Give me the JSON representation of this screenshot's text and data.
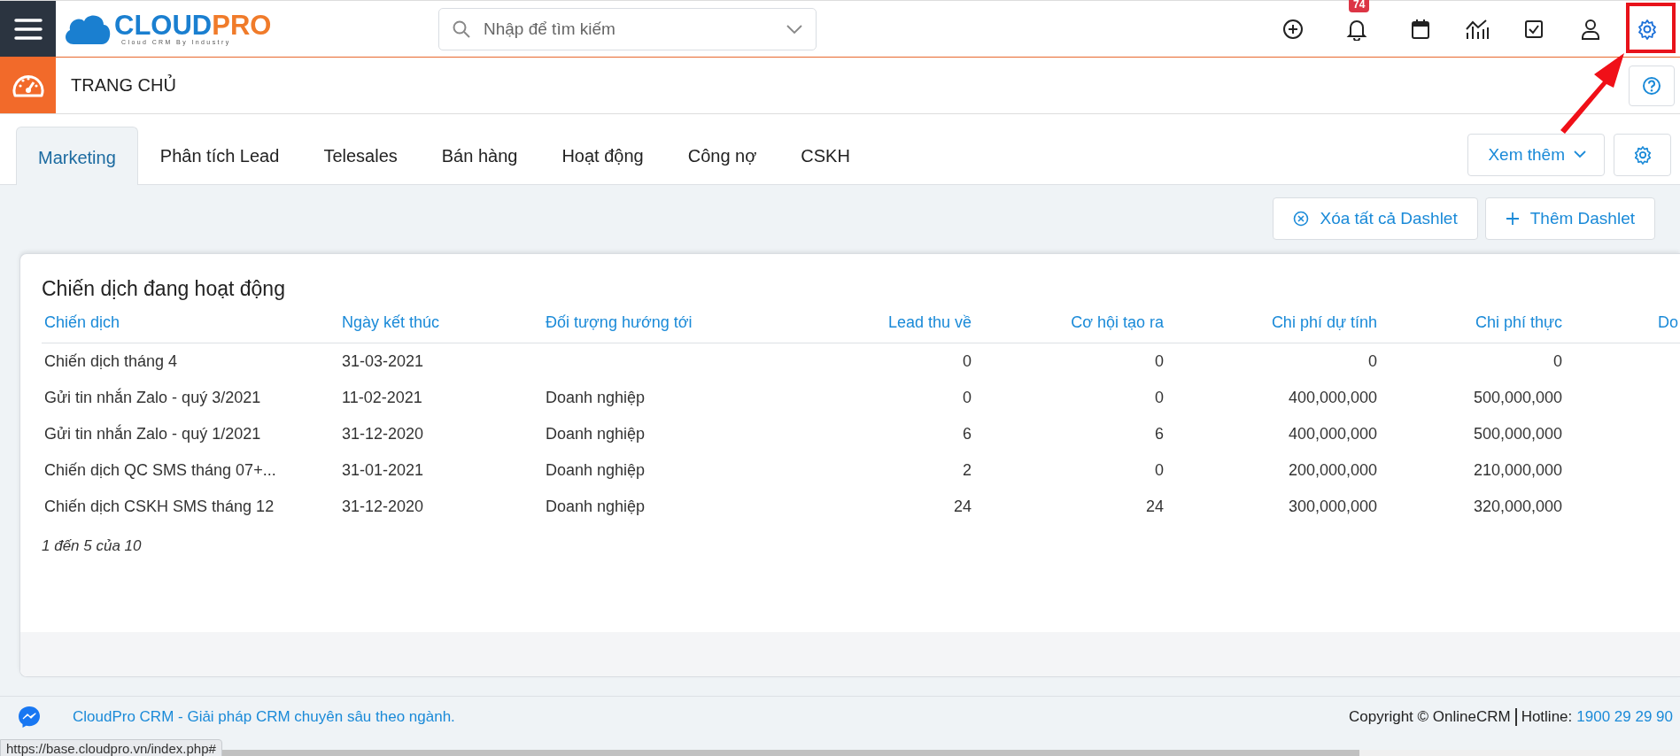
{
  "top_bar": {
    "logo": {
      "part_1": "CLOUD",
      "part_2": "PRO",
      "tagline": "Cloud CRM By Industry"
    },
    "search": {
      "placeholder": "Nhập để tìm kiếm"
    },
    "icons": [
      {
        "kind": "add"
      },
      {
        "kind": "bell",
        "badge": "74"
      },
      {
        "kind": "calendar"
      },
      {
        "kind": "chart"
      },
      {
        "kind": "task"
      },
      {
        "kind": "user"
      },
      {
        "kind": "settings"
      }
    ]
  },
  "page_header": {
    "title": "TRANG CHỦ"
  },
  "tabs": [
    {
      "label": "Marketing",
      "selected": true
    },
    {
      "label": "Phân tích Lead",
      "selected": false
    },
    {
      "label": "Telesales",
      "selected": false
    },
    {
      "label": "Bán hàng",
      "selected": false
    },
    {
      "label": "Hoạt động",
      "selected": false
    },
    {
      "label": "Công nợ",
      "selected": false
    },
    {
      "label": "CSKH",
      "selected": false
    }
  ],
  "more_button": "Xem thêm",
  "dashlet_buttons": [
    {
      "kind": "clear",
      "label": "Xóa tất cả Dashlet"
    },
    {
      "kind": "add",
      "label": "Thêm Dashlet"
    }
  ],
  "dashlet": {
    "title": "Chiến dịch đang hoạt động",
    "columns": [
      "Chiến dịch",
      "Ngày kết thúc",
      "Đối tượng hướng tới",
      "Lead thu về",
      "Cơ hội tạo ra",
      "Chi phí dự tính",
      "Chi phí thực",
      "Do"
    ],
    "rows": [
      [
        "Chiến dịch tháng 4",
        "31-03-2021",
        "",
        "0",
        "0",
        "0",
        "0"
      ],
      [
        "Gửi tin nhắn Zalo - quý 3/2021",
        "11-02-2021",
        "Doanh nghiệp",
        "0",
        "0",
        "400,000,000",
        "500,000,000"
      ],
      [
        "Gửi tin nhắn Zalo - quý 1/2021",
        "31-12-2020",
        "Doanh nghiệp",
        "6",
        "6",
        "400,000,000",
        "500,000,000"
      ],
      [
        "Chiến dịch QC SMS tháng 07+...",
        "31-01-2021",
        "Doanh nghiệp",
        "2",
        "0",
        "200,000,000",
        "210,000,000"
      ],
      [
        "Chiến dịch CSKH SMS tháng 12",
        "31-12-2020",
        "Doanh nghiệp",
        "24",
        "24",
        "300,000,000",
        "320,000,000"
      ]
    ],
    "pagination": "1 đến 5 của 10"
  },
  "footer": {
    "slogan": "CloudPro CRM - Giải pháp CRM chuyên sâu theo ngành.",
    "copyright": "Copyright © OnlineCRM",
    "hotline_label": "Hotline:",
    "hotline": "1900 29 29 90"
  },
  "status_url": "https://base.cloudpro.vn/index.php#"
}
